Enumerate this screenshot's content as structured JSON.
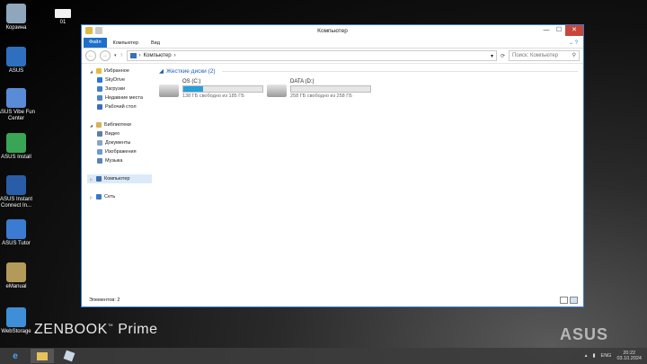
{
  "desktop": {
    "icons": [
      {
        "label": "Корзина",
        "name": "recycle-bin-icon"
      },
      {
        "label": "01",
        "name": "folder-icon"
      },
      {
        "label": "ASUS",
        "name": "asus-icon"
      },
      {
        "label": "ASUS Vibe Fun Center",
        "name": "asus-vibe-icon"
      },
      {
        "label": "ASUS Install",
        "name": "asus-install-icon"
      },
      {
        "label": "ASUS Instant Connect In...",
        "name": "asus-instant-connect-icon"
      },
      {
        "label": "ASUS Tutor",
        "name": "asus-tutor-icon"
      },
      {
        "label": "eManual",
        "name": "emanual-icon"
      },
      {
        "label": "WebStorage",
        "name": "webstorage-icon"
      }
    ],
    "brand": "ZENBOOK",
    "brand_suffix": "Prime",
    "watermark": "ASUS"
  },
  "window": {
    "title": "Компьютер",
    "ribbon": {
      "file": "Файл",
      "tabs": [
        "Компьютер",
        "Вид"
      ]
    },
    "address": {
      "path": "Компьютер",
      "search_placeholder": "Поиск: Компьютер"
    },
    "sidebar": [
      {
        "label": "Избранное",
        "sub": false,
        "icon": "star-icon",
        "color": "#e7b93c"
      },
      {
        "label": "SkyDrive",
        "sub": true,
        "icon": "cloud-icon",
        "color": "#2a78d4"
      },
      {
        "label": "Загрузки",
        "sub": true,
        "icon": "download-icon",
        "color": "#3f7fc8"
      },
      {
        "label": "Недавние места",
        "sub": true,
        "icon": "recent-icon",
        "color": "#4b87c9"
      },
      {
        "label": "Рабочий стол",
        "sub": true,
        "icon": "desktop-icon",
        "color": "#3a6fb5"
      },
      {
        "label": "Библиотеки",
        "sub": false,
        "icon": "library-icon",
        "color": "#d8b05a"
      },
      {
        "label": "Видео",
        "sub": true,
        "icon": "video-icon",
        "color": "#5d7fa8"
      },
      {
        "label": "Документы",
        "sub": true,
        "icon": "documents-icon",
        "color": "#8aa4c8"
      },
      {
        "label": "Изображения",
        "sub": true,
        "icon": "pictures-icon",
        "color": "#6a9bd0"
      },
      {
        "label": "Музыка",
        "sub": true,
        "icon": "music-icon",
        "color": "#5a84b8"
      },
      {
        "label": "Компьютер",
        "sub": false,
        "icon": "computer-icon",
        "color": "#3a6fb5",
        "selected": true
      },
      {
        "label": "Сеть",
        "sub": false,
        "icon": "network-icon",
        "color": "#3a78c8"
      }
    ],
    "group": {
      "label": "Жесткие диски (2)"
    },
    "drives": [
      {
        "name": "OS (C:)",
        "free_text": "138 ГБ свободно из 185 ГБ",
        "used_fraction": 0.25
      },
      {
        "name": "DATA (D:)",
        "free_text": "258 ГБ свободно из 258 ГБ",
        "used_fraction": 0.0
      }
    ],
    "status": "Элементов: 2"
  },
  "taskbar": {
    "lang": "ENG",
    "time": "20:22",
    "date": "03.10.2024"
  }
}
